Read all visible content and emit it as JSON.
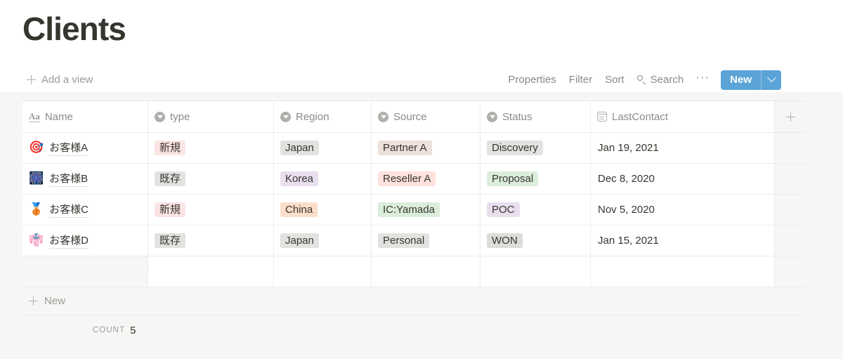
{
  "header": {
    "title": "Clients"
  },
  "viewbar": {
    "add_view_label": "Add a view",
    "add_view_icon": "plus-icon"
  },
  "toolbar": {
    "properties_label": "Properties",
    "filter_label": "Filter",
    "sort_label": "Sort",
    "search_label": "Search",
    "search_icon": "search-icon",
    "more_label": "···",
    "new_label": "New",
    "new_caret_icon": "chevron-down-icon",
    "new_button_color": "#5ba4d8"
  },
  "table": {
    "columns": [
      {
        "label": "Name",
        "icon": "text-property-icon"
      },
      {
        "label": "type",
        "icon": "select-property-icon"
      },
      {
        "label": "Region",
        "icon": "select-property-icon"
      },
      {
        "label": "Source",
        "icon": "select-property-icon"
      },
      {
        "label": "Status",
        "icon": "select-property-icon"
      },
      {
        "label": "LastContact",
        "icon": "date-property-icon"
      }
    ],
    "add_column_icon": "plus-icon",
    "rows": [
      {
        "emoji": "🎯",
        "emoji_name": "dart-icon",
        "name": "お客様A",
        "type": "新規",
        "type_color": "#fbe4e4",
        "region": "Japan",
        "region_color": "#e3e2e0",
        "source": "Partner A",
        "source_color": "#eee0da",
        "status": "Discovery",
        "status_color": "#e3e2e0",
        "last_contact": "Jan 19, 2021"
      },
      {
        "emoji": "🎆",
        "emoji_name": "fireworks-icon",
        "name": "お客様B",
        "type": "既存",
        "type_color": "#e3e2e0",
        "region": "Korea",
        "region_color": "#e8deee",
        "source": "Reseller A",
        "source_color": "#ffe2dd",
        "status": "Proposal",
        "status_color": "#dbeddb",
        "last_contact": "Dec 8, 2020"
      },
      {
        "emoji": "🥉",
        "emoji_name": "bronze-medal-icon",
        "name": "お客様C",
        "type": "新規",
        "type_color": "#fbe4e4",
        "region": "China",
        "region_color": "#fadec9",
        "source": "IC:Yamada",
        "source_color": "#dbeddb",
        "status": "POC",
        "status_color": "#e8deee",
        "last_contact": "Nov 5, 2020"
      },
      {
        "emoji": "👘",
        "emoji_name": "kimono-icon",
        "name": "お客様D",
        "type": "既存",
        "type_color": "#e3e2e0",
        "region": "Japan",
        "region_color": "#e3e2e0",
        "source": "Personal",
        "source_color": "#e3e2e0",
        "status": "WON",
        "status_color": "#dddcda",
        "last_contact": "Jan 15, 2021"
      },
      {
        "emoji": "",
        "emoji_name": "",
        "name": "",
        "type": "",
        "type_color": "transparent",
        "region": "",
        "region_color": "transparent",
        "source": "",
        "source_color": "transparent",
        "status": "",
        "status_color": "transparent",
        "last_contact": ""
      }
    ]
  },
  "footer": {
    "new_row_label": "New",
    "new_row_icon": "plus-icon",
    "count_label": "COUNT",
    "count_value": "5"
  }
}
